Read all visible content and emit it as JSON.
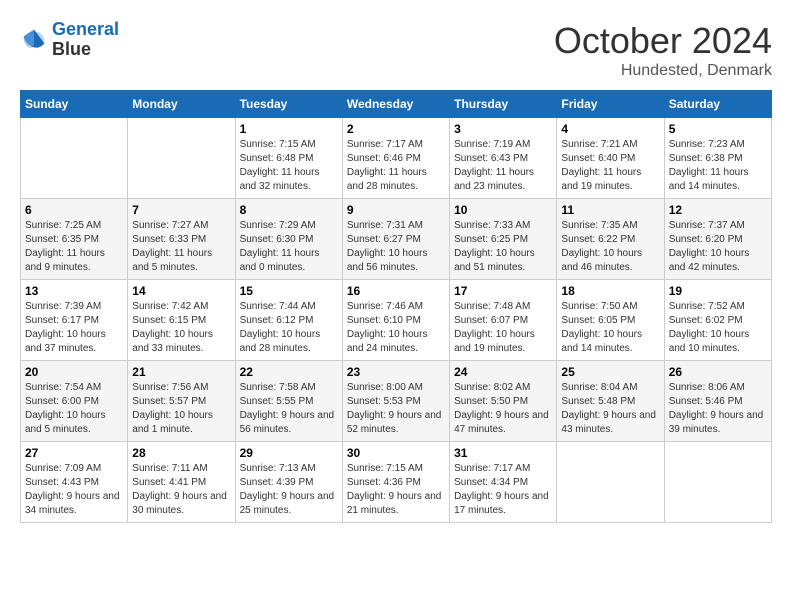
{
  "header": {
    "logo_line1": "General",
    "logo_line2": "Blue",
    "month": "October 2024",
    "location": "Hundested, Denmark"
  },
  "days_of_week": [
    "Sunday",
    "Monday",
    "Tuesday",
    "Wednesday",
    "Thursday",
    "Friday",
    "Saturday"
  ],
  "weeks": [
    [
      {
        "day": "",
        "sunrise": "",
        "sunset": "",
        "daylight": ""
      },
      {
        "day": "",
        "sunrise": "",
        "sunset": "",
        "daylight": ""
      },
      {
        "day": "1",
        "sunrise": "Sunrise: 7:15 AM",
        "sunset": "Sunset: 6:48 PM",
        "daylight": "Daylight: 11 hours and 32 minutes."
      },
      {
        "day": "2",
        "sunrise": "Sunrise: 7:17 AM",
        "sunset": "Sunset: 6:46 PM",
        "daylight": "Daylight: 11 hours and 28 minutes."
      },
      {
        "day": "3",
        "sunrise": "Sunrise: 7:19 AM",
        "sunset": "Sunset: 6:43 PM",
        "daylight": "Daylight: 11 hours and 23 minutes."
      },
      {
        "day": "4",
        "sunrise": "Sunrise: 7:21 AM",
        "sunset": "Sunset: 6:40 PM",
        "daylight": "Daylight: 11 hours and 19 minutes."
      },
      {
        "day": "5",
        "sunrise": "Sunrise: 7:23 AM",
        "sunset": "Sunset: 6:38 PM",
        "daylight": "Daylight: 11 hours and 14 minutes."
      }
    ],
    [
      {
        "day": "6",
        "sunrise": "Sunrise: 7:25 AM",
        "sunset": "Sunset: 6:35 PM",
        "daylight": "Daylight: 11 hours and 9 minutes."
      },
      {
        "day": "7",
        "sunrise": "Sunrise: 7:27 AM",
        "sunset": "Sunset: 6:33 PM",
        "daylight": "Daylight: 11 hours and 5 minutes."
      },
      {
        "day": "8",
        "sunrise": "Sunrise: 7:29 AM",
        "sunset": "Sunset: 6:30 PM",
        "daylight": "Daylight: 11 hours and 0 minutes."
      },
      {
        "day": "9",
        "sunrise": "Sunrise: 7:31 AM",
        "sunset": "Sunset: 6:27 PM",
        "daylight": "Daylight: 10 hours and 56 minutes."
      },
      {
        "day": "10",
        "sunrise": "Sunrise: 7:33 AM",
        "sunset": "Sunset: 6:25 PM",
        "daylight": "Daylight: 10 hours and 51 minutes."
      },
      {
        "day": "11",
        "sunrise": "Sunrise: 7:35 AM",
        "sunset": "Sunset: 6:22 PM",
        "daylight": "Daylight: 10 hours and 46 minutes."
      },
      {
        "day": "12",
        "sunrise": "Sunrise: 7:37 AM",
        "sunset": "Sunset: 6:20 PM",
        "daylight": "Daylight: 10 hours and 42 minutes."
      }
    ],
    [
      {
        "day": "13",
        "sunrise": "Sunrise: 7:39 AM",
        "sunset": "Sunset: 6:17 PM",
        "daylight": "Daylight: 10 hours and 37 minutes."
      },
      {
        "day": "14",
        "sunrise": "Sunrise: 7:42 AM",
        "sunset": "Sunset: 6:15 PM",
        "daylight": "Daylight: 10 hours and 33 minutes."
      },
      {
        "day": "15",
        "sunrise": "Sunrise: 7:44 AM",
        "sunset": "Sunset: 6:12 PM",
        "daylight": "Daylight: 10 hours and 28 minutes."
      },
      {
        "day": "16",
        "sunrise": "Sunrise: 7:46 AM",
        "sunset": "Sunset: 6:10 PM",
        "daylight": "Daylight: 10 hours and 24 minutes."
      },
      {
        "day": "17",
        "sunrise": "Sunrise: 7:48 AM",
        "sunset": "Sunset: 6:07 PM",
        "daylight": "Daylight: 10 hours and 19 minutes."
      },
      {
        "day": "18",
        "sunrise": "Sunrise: 7:50 AM",
        "sunset": "Sunset: 6:05 PM",
        "daylight": "Daylight: 10 hours and 14 minutes."
      },
      {
        "day": "19",
        "sunrise": "Sunrise: 7:52 AM",
        "sunset": "Sunset: 6:02 PM",
        "daylight": "Daylight: 10 hours and 10 minutes."
      }
    ],
    [
      {
        "day": "20",
        "sunrise": "Sunrise: 7:54 AM",
        "sunset": "Sunset: 6:00 PM",
        "daylight": "Daylight: 10 hours and 5 minutes."
      },
      {
        "day": "21",
        "sunrise": "Sunrise: 7:56 AM",
        "sunset": "Sunset: 5:57 PM",
        "daylight": "Daylight: 10 hours and 1 minute."
      },
      {
        "day": "22",
        "sunrise": "Sunrise: 7:58 AM",
        "sunset": "Sunset: 5:55 PM",
        "daylight": "Daylight: 9 hours and 56 minutes."
      },
      {
        "day": "23",
        "sunrise": "Sunrise: 8:00 AM",
        "sunset": "Sunset: 5:53 PM",
        "daylight": "Daylight: 9 hours and 52 minutes."
      },
      {
        "day": "24",
        "sunrise": "Sunrise: 8:02 AM",
        "sunset": "Sunset: 5:50 PM",
        "daylight": "Daylight: 9 hours and 47 minutes."
      },
      {
        "day": "25",
        "sunrise": "Sunrise: 8:04 AM",
        "sunset": "Sunset: 5:48 PM",
        "daylight": "Daylight: 9 hours and 43 minutes."
      },
      {
        "day": "26",
        "sunrise": "Sunrise: 8:06 AM",
        "sunset": "Sunset: 5:46 PM",
        "daylight": "Daylight: 9 hours and 39 minutes."
      }
    ],
    [
      {
        "day": "27",
        "sunrise": "Sunrise: 7:09 AM",
        "sunset": "Sunset: 4:43 PM",
        "daylight": "Daylight: 9 hours and 34 minutes."
      },
      {
        "day": "28",
        "sunrise": "Sunrise: 7:11 AM",
        "sunset": "Sunset: 4:41 PM",
        "daylight": "Daylight: 9 hours and 30 minutes."
      },
      {
        "day": "29",
        "sunrise": "Sunrise: 7:13 AM",
        "sunset": "Sunset: 4:39 PM",
        "daylight": "Daylight: 9 hours and 25 minutes."
      },
      {
        "day": "30",
        "sunrise": "Sunrise: 7:15 AM",
        "sunset": "Sunset: 4:36 PM",
        "daylight": "Daylight: 9 hours and 21 minutes."
      },
      {
        "day": "31",
        "sunrise": "Sunrise: 7:17 AM",
        "sunset": "Sunset: 4:34 PM",
        "daylight": "Daylight: 9 hours and 17 minutes."
      },
      {
        "day": "",
        "sunrise": "",
        "sunset": "",
        "daylight": ""
      },
      {
        "day": "",
        "sunrise": "",
        "sunset": "",
        "daylight": ""
      }
    ]
  ]
}
